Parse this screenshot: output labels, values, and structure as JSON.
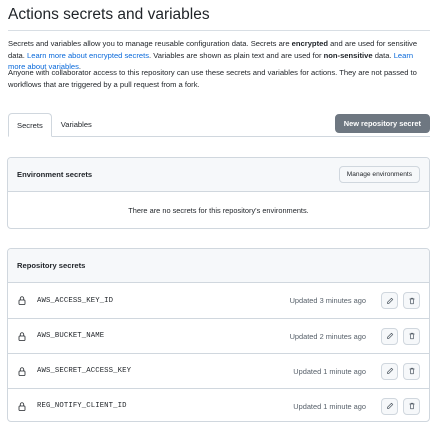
{
  "page": {
    "title": "Actions secrets and variables"
  },
  "intro": {
    "p1_a": "Secrets and variables allow you to manage reusable configuration data. Secrets are ",
    "p1_b": "encrypted",
    "p1_c": " and are used for sensitive data. ",
    "p1_link1": "Learn more about encrypted secrets",
    "p1_d": ". Variables are shown as plain text and are used for ",
    "p1_e": "non-sensitive",
    "p1_f": " data. ",
    "p1_link2": "Learn more about variables",
    "p1_g": ".",
    "p2": "Anyone with collaborator access to this repository can use these secrets and variables for actions. They are not passed to workflows that are triggered by a pull request from a fork."
  },
  "tabs": [
    {
      "label": "Secrets",
      "active": true
    },
    {
      "label": "Variables",
      "active": false
    }
  ],
  "new_secret_button": "New repository secret",
  "environment": {
    "title": "Environment secrets",
    "manage_button": "Manage environments",
    "empty_message": "There are no secrets for this repository's environments."
  },
  "repository": {
    "title": "Repository secrets",
    "secrets": [
      {
        "name": "AWS_ACCESS_KEY_ID",
        "updated": "Updated 3 minutes ago"
      },
      {
        "name": "AWS_BUCKET_NAME",
        "updated": "Updated 2 minutes ago"
      },
      {
        "name": "AWS_SECRET_ACCESS_KEY",
        "updated": "Updated 1 minute ago"
      },
      {
        "name": "REG_NOTIFY_CLIENT_ID",
        "updated": "Updated 1 minute ago"
      }
    ]
  },
  "icons": {
    "lock": "lock-icon",
    "edit": "pencil-icon",
    "delete": "trash-icon"
  },
  "colors": {
    "link": "#0969da",
    "button_disabled": "#6e7781",
    "border": "#d0d7de",
    "header_bg": "#f6f8fa"
  }
}
